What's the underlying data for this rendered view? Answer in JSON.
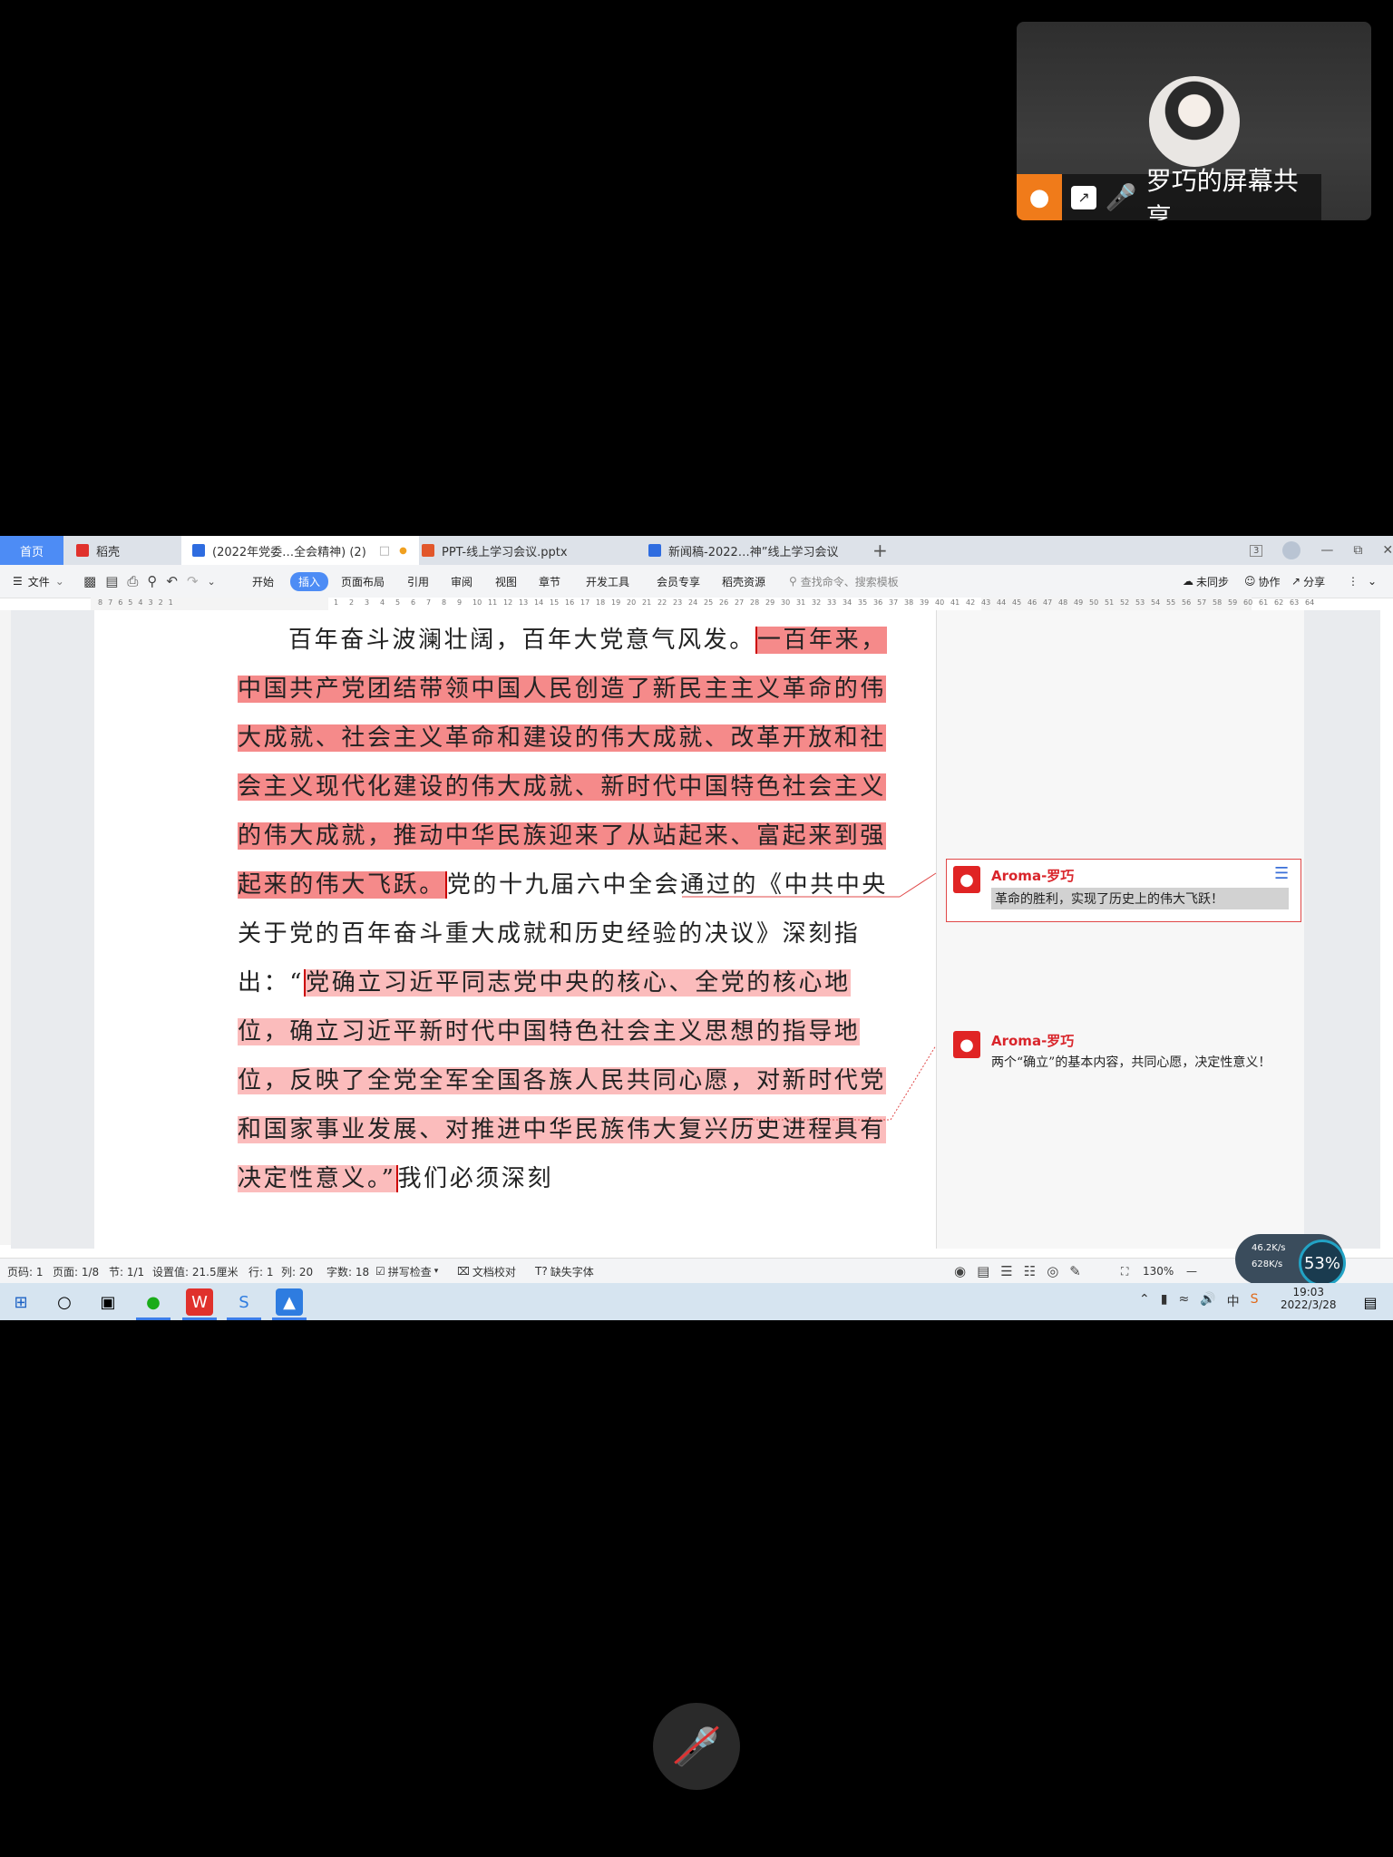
{
  "share": {
    "name": "罗巧的屏幕共享"
  },
  "tabs": {
    "home": "首页",
    "wps": "稻壳",
    "doc1": "(2022年党委…全会精神) (2)",
    "ppt": "PPT-线上学习会议.pptx",
    "doc2": "新闻稿-2022…神”线上学习会议",
    "add": "+"
  },
  "window": {
    "badge": "3"
  },
  "menu": {
    "file": "文件",
    "items": [
      "开始",
      "插入",
      "页面布局",
      "引用",
      "审阅",
      "视图",
      "章节",
      "开发工具",
      "会员专享",
      "稻壳资源"
    ],
    "active": "插入",
    "search_placeholder": "查找命令、搜索模板",
    "sync": "未同步",
    "collab": "协作",
    "share": "分享"
  },
  "ruler": {
    "left": [
      "8",
      "7",
      "6",
      "5",
      "4",
      "3",
      "2",
      "1"
    ],
    "right": [
      "1",
      "2",
      "3",
      "4",
      "5",
      "6",
      "7",
      "8",
      "9",
      "10",
      "11",
      "12",
      "13",
      "14",
      "15",
      "16",
      "17",
      "18",
      "19",
      "20",
      "21",
      "22",
      "23",
      "24",
      "25",
      "26",
      "27",
      "28",
      "29",
      "30",
      "31",
      "32",
      "33",
      "34",
      "35",
      "36",
      "37",
      "38",
      "39",
      "40",
      "41",
      "42",
      "43",
      "44",
      "45",
      "46",
      "47",
      "48",
      "49",
      "50",
      "51",
      "52",
      "53",
      "54",
      "55",
      "56",
      "57",
      "58",
      "59",
      "60",
      "61",
      "62",
      "63",
      "64"
    ]
  },
  "document": {
    "p1_plain": "百年奋斗波澜壮阔，百年大党意气风发。",
    "p1_hl": "一百年来，中国共产党团结带领中国人民创造了新民主主义革命的伟大成就、社会主义革命和建设的伟大成就、改革开放和社会主义现代化建设的伟大成就、新时代中国特色社会主义的伟大成就，推动中华民族迎来了从站起来、富起来到强起来的伟大飞跃。",
    "p2_plain": "党的十九届六中全会通过的《中共中央关于党的百年奋斗重大成就和历史经验的决议》深刻指出：“",
    "p2_hl": "党确立习近平同志党中央的核心、全党的核心地位，确立习近平新时代中国特色社会主义思想的指导地位，反映了全党全军全国各族人民共同心愿，对新时代党和国家事业发展、对推进中华民族伟大复兴历史进程具有决定性意义。”",
    "p2_tail": "我们必须深刻"
  },
  "comments": [
    {
      "author": "Aroma-罗巧",
      "text": "革命的胜利，实现了历史上的伟大飞跃！"
    },
    {
      "author": "Aroma-罗巧",
      "text": "两个“确立”的基本内容，共同心愿，决定性意义！"
    }
  ],
  "status": {
    "page": "页码: 1",
    "pages": "页面: 1/8",
    "section": "节: 1/1",
    "setting": "设置值: 21.5厘米",
    "row": "行: 1",
    "col": "列: 20",
    "words": "字数: 18",
    "spell": "拼写检查",
    "proof": "文档校对",
    "font_missing": "缺失字体",
    "zoom": "130%"
  },
  "network": {
    "up": "46.2K/s",
    "down": "628K/s",
    "percent": "53%"
  },
  "taskbar": {
    "time": "19:03",
    "date": "2022/3/28",
    "ime": "中"
  }
}
